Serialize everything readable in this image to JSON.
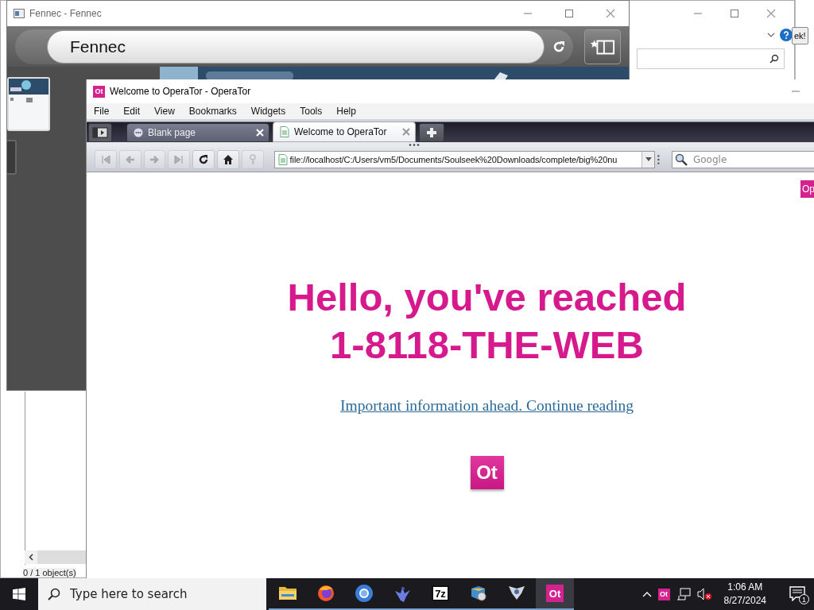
{
  "background_window": {
    "button_text": "ek!",
    "status_text": "0 / 1 object(s)"
  },
  "fennec": {
    "title": "Fennec - Fennec",
    "url": "Fennec"
  },
  "opera": {
    "icon_text": "Ot",
    "title": "Welcome to OperaTor - OperaTor",
    "menu": [
      "File",
      "Edit",
      "View",
      "Bookmarks",
      "Widgets",
      "Tools",
      "Help"
    ],
    "tabs": [
      {
        "label": "Blank page",
        "selected": false
      },
      {
        "label": "Welcome to OperaTor",
        "selected": true
      }
    ],
    "address": "file://localhost/C:/Users/vm5/Documents/Soulseek%20Downloads/complete/big%20nu",
    "search": {
      "placeholder": "Google"
    },
    "page": {
      "corner_badge": "Op",
      "heading_lines": [
        "Hello, you've reached",
        "1-8118-THE-WEB"
      ],
      "link": "Important information ahead. Continue reading",
      "logo": "Ot"
    }
  },
  "taskbar": {
    "search": {
      "placeholder": "Type here to search"
    },
    "apps": [
      {
        "kind": "folder",
        "active": false
      },
      {
        "kind": "firefox",
        "active": false
      },
      {
        "kind": "chromium",
        "active": false
      },
      {
        "kind": "bird",
        "active": false
      },
      {
        "kind": "archiver",
        "label": "7z",
        "active": false
      },
      {
        "kind": "installer",
        "active": false
      },
      {
        "kind": "winged",
        "active": false
      },
      {
        "kind": "operator",
        "label": "Ot",
        "active": true
      }
    ],
    "tray": {
      "app_badge": "Ot",
      "time": "1:06 AM",
      "date": "8/27/2024",
      "notifications": "1"
    }
  }
}
